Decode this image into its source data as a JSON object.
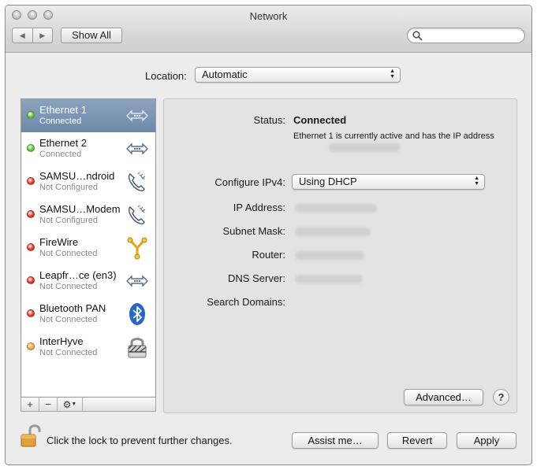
{
  "window": {
    "title": "Network",
    "show_all_label": "Show All"
  },
  "location": {
    "label": "Location:",
    "value": "Automatic"
  },
  "services": [
    {
      "name": "Ethernet 1",
      "status": "Connected",
      "status_color": "#5ec43a",
      "icon": "ethernet-icon",
      "selected": true
    },
    {
      "name": "Ethernet 2",
      "status": "Connected",
      "status_color": "#5ec43a",
      "icon": "ethernet-icon",
      "selected": false
    },
    {
      "name": "SAMSU…ndroid",
      "status": "Not Configured",
      "status_color": "#e0322a",
      "icon": "phone-icon",
      "selected": false
    },
    {
      "name": "SAMSU…Modem",
      "status": "Not Configured",
      "status_color": "#e0322a",
      "icon": "phone-icon",
      "selected": false
    },
    {
      "name": "FireWire",
      "status": "Not Connected",
      "status_color": "#e0322a",
      "icon": "firewire-icon",
      "selected": false
    },
    {
      "name": "Leapfr…ce (en3)",
      "status": "Not Connected",
      "status_color": "#e0322a",
      "icon": "ethernet-icon",
      "selected": false
    },
    {
      "name": "Bluetooth PAN",
      "status": "Not Connected",
      "status_color": "#e0322a",
      "icon": "bluetooth-icon",
      "selected": false
    },
    {
      "name": "InterHyve",
      "status": "Not Connected",
      "status_color": "#f0a13a",
      "icon": "vpn-lock-icon",
      "selected": false
    }
  ],
  "list_toolbar": {
    "add": "+",
    "remove": "−"
  },
  "detail": {
    "status_label": "Status:",
    "status_value": "Connected",
    "status_description": "Ethernet 1 is currently active and has the IP address",
    "configure_label": "Configure IPv4:",
    "configure_value": "Using DHCP",
    "ip_label": "IP Address:",
    "subnet_label": "Subnet Mask:",
    "router_label": "Router:",
    "dns_label": "DNS Server:",
    "search_domains_label": "Search Domains:",
    "advanced_label": "Advanced…",
    "help_label": "?"
  },
  "footer": {
    "lock_text": "Click the lock to prevent further changes.",
    "assist_label": "Assist me…",
    "revert_label": "Revert",
    "apply_label": "Apply"
  }
}
